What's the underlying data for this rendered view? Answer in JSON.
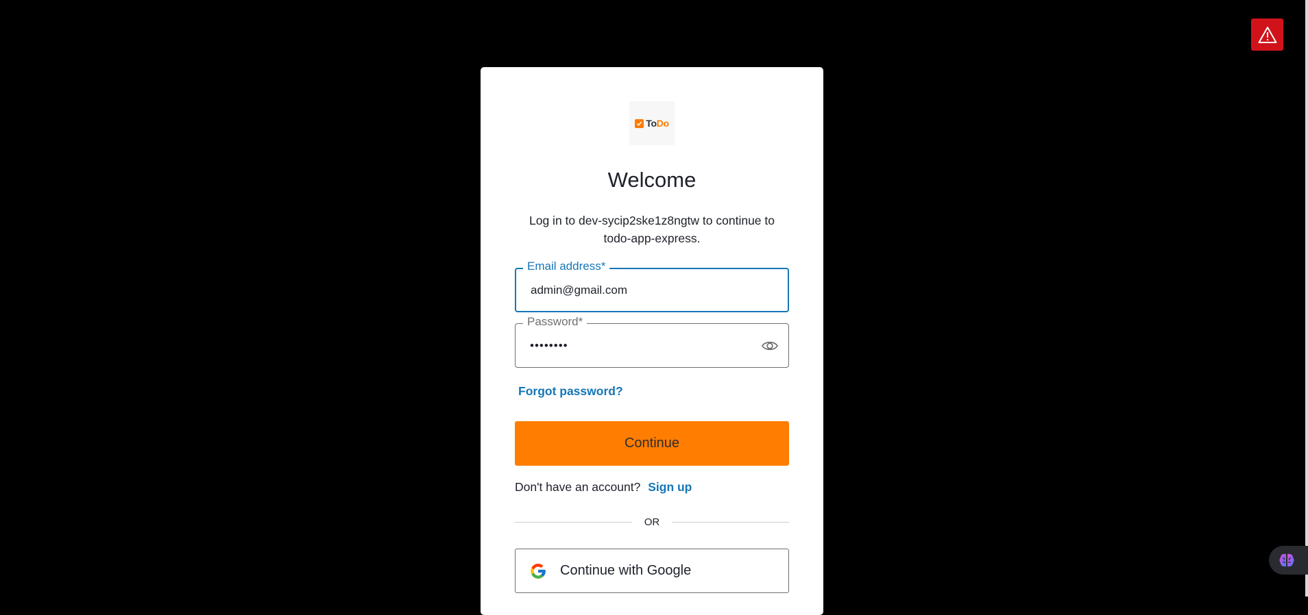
{
  "logo": {
    "text_part1": "To",
    "text_part2": "Do"
  },
  "login": {
    "title": "Welcome",
    "subtitle": "Log in to dev-sycip2ske1z8ngtw to continue to todo-app-express.",
    "email_label": "Email address*",
    "email_value": "admin@gmail.com",
    "password_label": "Password*",
    "password_value": "••••••••",
    "forgot_password": "Forgot password?",
    "continue_label": "Continue",
    "no_account_text": "Don't have an account?",
    "signup_label": "Sign up",
    "or_text": "OR",
    "google_label": "Continue with Google"
  },
  "icons": {
    "alert": "warning-icon",
    "eye": "eye-icon",
    "google": "google-icon",
    "extension": "brain-icon"
  },
  "colors": {
    "accent_orange": "#ff7d00",
    "link_blue": "#1576b7",
    "alert_red": "#d0131b"
  }
}
